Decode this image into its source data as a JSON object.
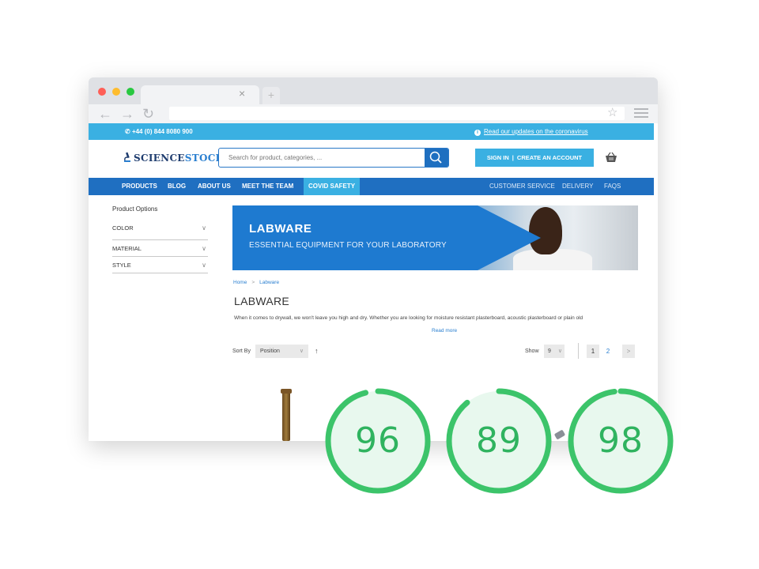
{
  "browser": {
    "tab_close_glyph": "×",
    "new_tab_glyph": "+",
    "back_glyph": "←",
    "forward_glyph": "→",
    "reload_glyph": "↻",
    "bookmark_glyph": "☆"
  },
  "site": {
    "topbar": {
      "phone": "+44 (0) 844 8080 900",
      "covid_link": "Read our updates on the coronavirus"
    },
    "logo": {
      "part1": "SCIENCE",
      "part2": "STOCK"
    },
    "search": {
      "placeholder": "Search for product, categories, ..."
    },
    "auth": {
      "sign_in": "SIGN IN",
      "separator": "|",
      "create_account": "CREATE AN ACCOUNT"
    },
    "nav": {
      "left": [
        "PRODUCTS",
        "BLOG",
        "ABOUT US",
        "MEET THE TEAM",
        "COVID SAFETY"
      ],
      "right": [
        "CUSTOMER SERVICE",
        "DELIVERY",
        "FAQS"
      ]
    },
    "sidebar": {
      "title": "Product Options",
      "filters": [
        "COLOR",
        "MATERIAL",
        "STYLE"
      ]
    },
    "banner": {
      "title": "LABWARE",
      "subtitle": "ESSENTIAL EQUIPMENT FOR YOUR LABORATORY"
    },
    "breadcrumb": {
      "home": "Home",
      "separator": ">",
      "current": "Labware"
    },
    "page_title": "LABWARE",
    "description": "When it comes to drywall, we won't leave you high and dry. Whether you are looking for moisture resistant plasterboard, acoustic plasterboard or plain old",
    "read_more": "Read more",
    "toolbar": {
      "sort_label": "Sort By",
      "sort_value": "Position",
      "sort_direction_glyph": "↑",
      "show_label": "Show",
      "show_value": "9",
      "pages": [
        "1",
        "2"
      ],
      "next_glyph": ">"
    }
  },
  "scores": [
    {
      "value": "96"
    },
    {
      "value": "89"
    },
    {
      "value": "98"
    }
  ],
  "colors": {
    "topbar": "#3ab0e2",
    "nav": "#1f6fc1",
    "score_ring": "#2fb35f",
    "score_fill": "#e8f8ee"
  }
}
